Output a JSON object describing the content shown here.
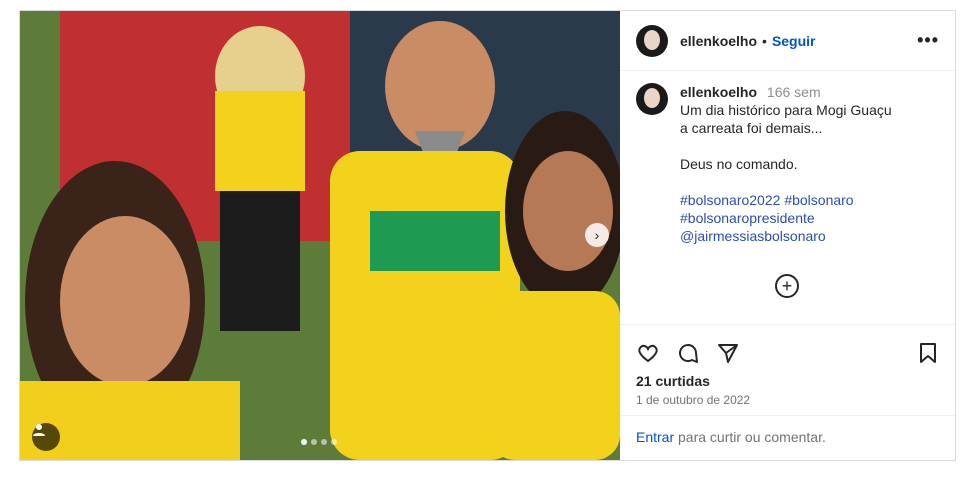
{
  "header": {
    "username": "ellenkoelho",
    "separator": "•",
    "follow_label": "Seguir",
    "more_label": "•••"
  },
  "caption": {
    "username": "ellenkoelho",
    "time": "166 sem",
    "lines": [
      "Um dia histórico para Mogi Guaçu",
      "a carreata foi demais..."
    ],
    "line3": "Deus no comando.",
    "hashtags": [
      "#bolsonaro2022",
      "#bolsonaro",
      "#bolsonaropresidente",
      "@jairmessiasbolsonaro"
    ]
  },
  "actions": {
    "likes": "21 curtidas",
    "date": "1 de outubro de 2022"
  },
  "login": {
    "link_label": "Entrar",
    "text": "para curtir ou comentar."
  },
  "carousel": {
    "dots": 4,
    "active_dot": 1
  },
  "icons": [
    "heart-icon",
    "comment-icon",
    "share-icon",
    "bookmark-icon",
    "add-comment-icon",
    "next-arrow-icon",
    "tag-user-icon",
    "more-icon"
  ]
}
